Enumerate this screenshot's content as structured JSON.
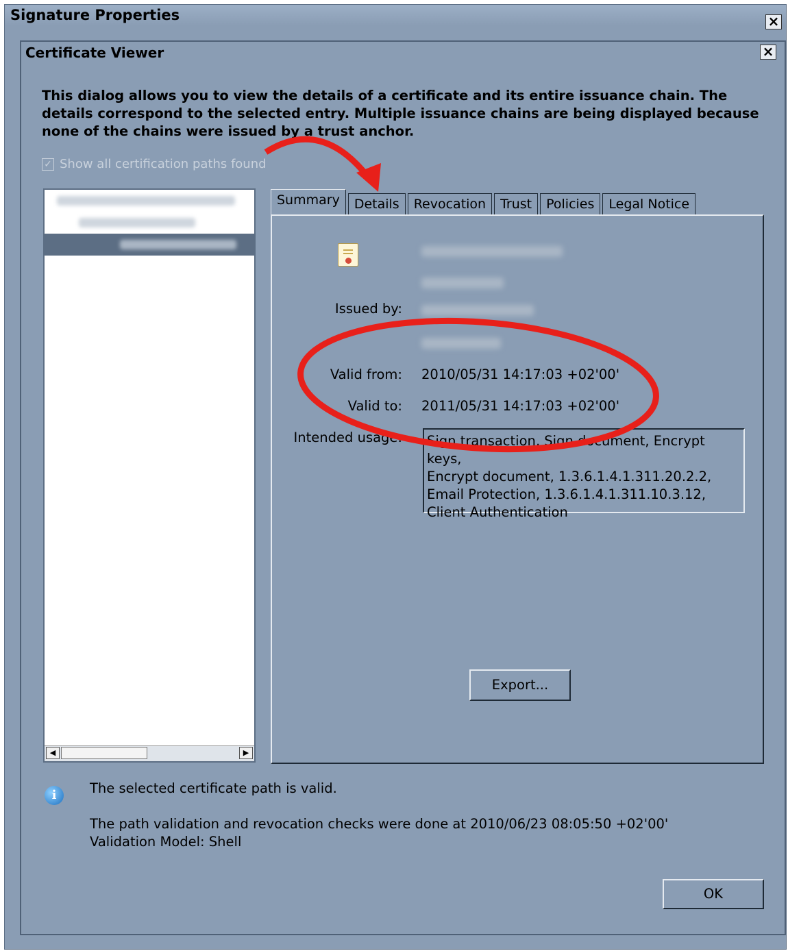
{
  "outer_window": {
    "title": "Signature Properties"
  },
  "inner_window": {
    "title": "Certificate Viewer"
  },
  "description": "This dialog allows you to view the details of a certificate and its entire issuance chain. The details correspond to the selected entry. Multiple issuance chains are being displayed because none of the chains were issued by a trust anchor.",
  "show_all_paths": {
    "label": "Show all certification paths found",
    "checked": true
  },
  "tabs": [
    {
      "label": "Summary",
      "active": true
    },
    {
      "label": "Details"
    },
    {
      "label": "Revocation"
    },
    {
      "label": "Trust"
    },
    {
      "label": "Policies"
    },
    {
      "label": "Legal Notice"
    }
  ],
  "summary": {
    "issued_by_label": "Issued by:",
    "valid_from_label": "Valid from:",
    "valid_from": "2010/05/31 14:17:03 +02'00'",
    "valid_to_label": "Valid to:",
    "valid_to": "2011/05/31 14:17:03 +02'00'",
    "intended_usage_label": "Intended usage:",
    "intended_usage": [
      "Sign transaction, Sign document, Encrypt keys,",
      "Encrypt document, 1.3.6.1.4.1.311.20.2.2,",
      "Email Protection, 1.3.6.1.4.1.311.10.3.12,",
      "Client Authentication"
    ],
    "export_label": "Export..."
  },
  "status": {
    "valid_text": "The selected certificate path is valid.",
    "check_text": "The path validation and revocation checks were done at 2010/06/23 08:05:50 +02'00'",
    "model_text": "Validation Model: Shell"
  },
  "ok_label": "OK",
  "close_glyph": "×",
  "icons": [
    "close-icon",
    "checkbox-icon",
    "certificate-icon",
    "info-icon",
    "scroll-left-icon",
    "scroll-right-icon"
  ],
  "annotation_color": "#e8201a"
}
